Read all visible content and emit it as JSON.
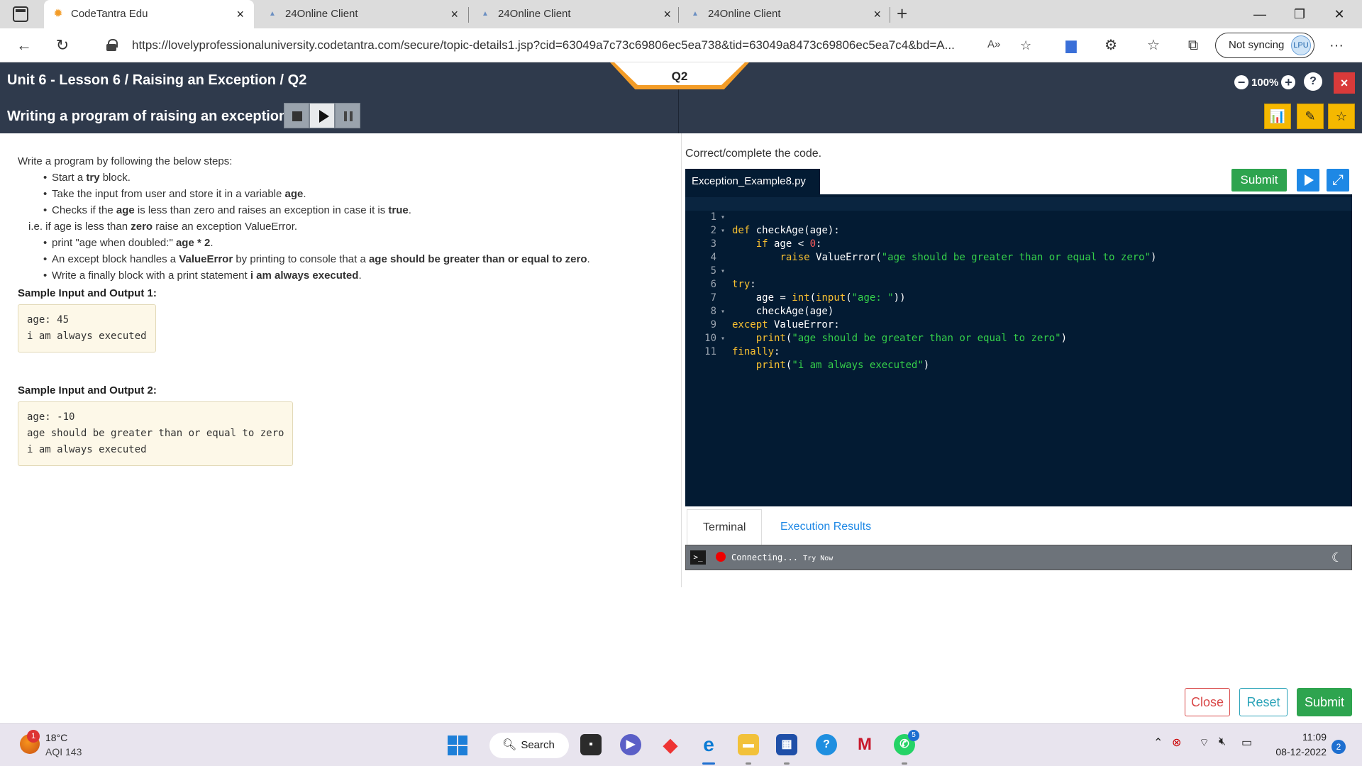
{
  "browser": {
    "tabs": [
      {
        "title": "CodeTantra Edu",
        "active": true,
        "icon": "sun-favicon"
      },
      {
        "title": "24Online Client",
        "active": false,
        "icon": "triangle-favicon"
      },
      {
        "title": "24Online Client",
        "active": false,
        "icon": "triangle-favicon"
      },
      {
        "title": "24Online Client",
        "active": false,
        "icon": "triangle-favicon"
      }
    ],
    "url": "https://lovelyprofessionaluniversity.codetantra.com/secure/topic-details1.jsp?cid=63049a7c73c69806ec5ea738&tid=63049a8473c69806ec5ea7c4&bd=A...",
    "sync_label": "Not syncing",
    "avatar_text": "LPU"
  },
  "header": {
    "lesson_title": "Unit 6 - Lesson 6 / Raising an Exception / Q2",
    "program_title": "Writing a program of raising an exception",
    "question_label": "Q2",
    "zoom": "100%",
    "help": "?",
    "close": "×"
  },
  "problem": {
    "intro": "Write a program by following the below steps:",
    "sample1_title": "Sample Input and Output 1:",
    "sample1_lines": [
      "age: 45",
      "i am always executed"
    ],
    "sample2_title": "Sample Input and Output 2:",
    "sample2_lines": [
      "age: -10",
      "age should be greater than or equal to zero",
      "i am always executed"
    ]
  },
  "editor": {
    "instruction": "Correct/complete the code.",
    "file_name": "Exception_Example8.py",
    "submit_label": "Submit",
    "line_count": 11
  },
  "terminal": {
    "tab_terminal": "Terminal",
    "tab_results": "Execution Results",
    "prompt_icon": ">_",
    "status": "Connecting...",
    "retry": "Try Now"
  },
  "actions": {
    "close": "Close",
    "reset": "Reset",
    "submit": "Submit"
  },
  "taskbar": {
    "weather_badge": "1",
    "temperature": "18°C",
    "aqi": "AQI 143",
    "search_label": "Search",
    "whatsapp_badge": "5",
    "time": "11:09",
    "date": "08-12-2022",
    "notifications": "2"
  },
  "colors": {
    "header_bg": "#2f3a4c",
    "editor_bg": "#031b33",
    "accent_orange": "#f39c27",
    "submit_green": "#2ea44f",
    "keyword_yellow": "#f8c131",
    "string_green": "#35d04a"
  }
}
